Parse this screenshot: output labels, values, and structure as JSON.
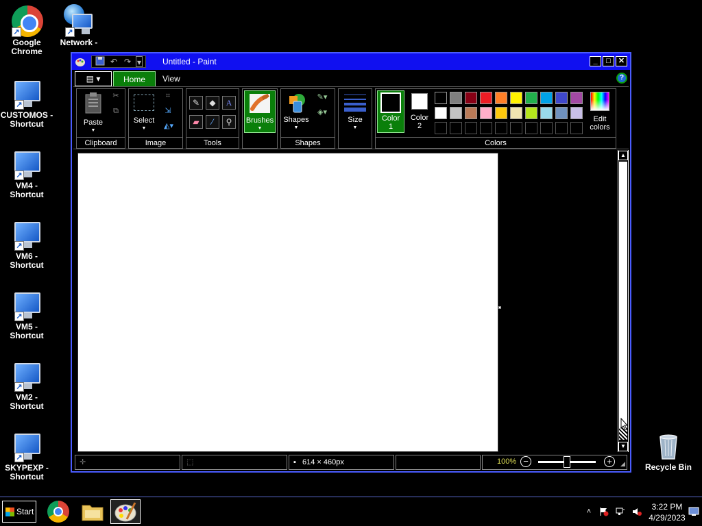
{
  "desktop": {
    "icons": [
      {
        "label": "Google Chrome"
      },
      {
        "label": "Network - Shortcut"
      },
      {
        "label": "CUSTOMOS - Shortcut"
      },
      {
        "label": "VM4 - Shortcut"
      },
      {
        "label": "VM6 - Shortcut"
      },
      {
        "label": "VM5 - Shortcut"
      },
      {
        "label": "VM2 - Shortcut"
      },
      {
        "label": "SKYPEXP - Shortcut"
      },
      {
        "label": "Recycle Bin"
      }
    ]
  },
  "window": {
    "title": "Untitled - Paint",
    "tabs": [
      {
        "label": "Home",
        "active": true
      },
      {
        "label": "View",
        "active": false
      }
    ],
    "ribbon": {
      "clipboard": {
        "paste": "Paste",
        "group": "Clipboard"
      },
      "image": {
        "select": "Select",
        "group": "Image"
      },
      "tools": {
        "group": "Tools"
      },
      "brushes": {
        "label": "Brushes"
      },
      "shapes": {
        "label": "Shapes",
        "group": "Shapes"
      },
      "size": {
        "label": "Size"
      },
      "colors": {
        "color1": "Color 1",
        "color2": "Color 2",
        "edit": "Edit colors",
        "group": "Colors",
        "color1_value": "#000000",
        "color2_value": "#ffffff",
        "row1": [
          "#000000",
          "#7f7f7f",
          "#880015",
          "#ed1c24",
          "#ff7f27",
          "#fff200",
          "#22b14c",
          "#00a2e8",
          "#3f48cc",
          "#a349a4"
        ],
        "row2": [
          "#ffffff",
          "#c3c3c3",
          "#b97a57",
          "#ffaec9",
          "#ffc90e",
          "#efe4b0",
          "#b5e61d",
          "#99d9ea",
          "#7092be",
          "#c8bfe7"
        ]
      }
    },
    "status": {
      "dimensions": "614 × 460px",
      "zoom": "100%"
    }
  },
  "taskbar": {
    "start": "Start",
    "time": "3:22 PM",
    "date": "4/29/2023"
  },
  "colors": {
    "titlebar": "#1010f0",
    "active_tab": "#0a7f0a"
  }
}
